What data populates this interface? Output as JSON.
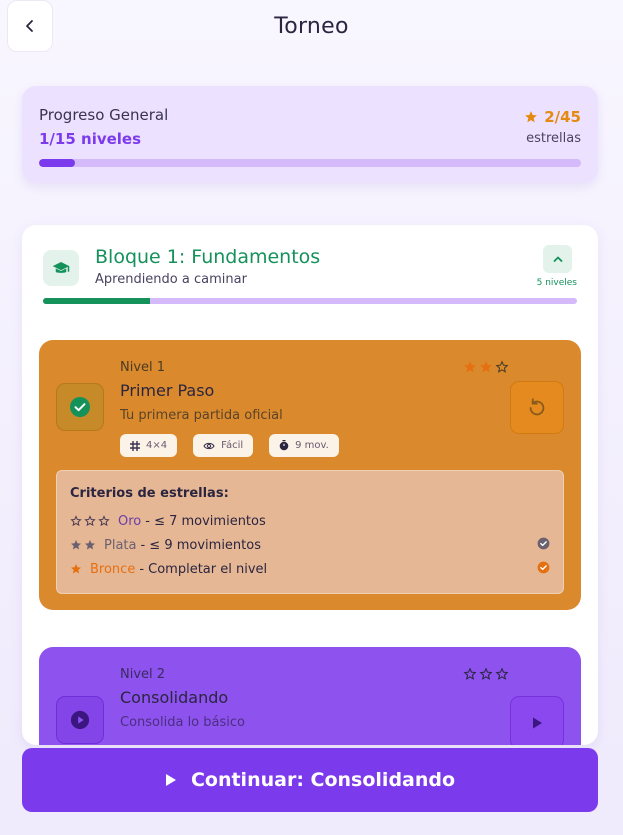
{
  "header": {
    "title": "Torneo"
  },
  "progress": {
    "label": "Progreso General",
    "levels_text": "1/15 niveles",
    "stars_text": "2/45",
    "stars_label": "estrellas",
    "fraction": 0.066
  },
  "block": {
    "title": "Bloque 1: Fundamentos",
    "subtitle": "Aprendiendo a caminar",
    "count": "5 niveles",
    "fraction": 0.2
  },
  "levels": [
    {
      "number": "Nivel 1",
      "name": "Primer Paso",
      "description": "Tu primera partida oficial",
      "stars_earned": 2,
      "stars_total": 3,
      "chips": {
        "grid": "4×4",
        "difficulty": "Fácil",
        "moves": "9 mov."
      }
    },
    {
      "number": "Nivel 2",
      "name": "Consolidando",
      "description": "Consolida lo básico",
      "stars_earned": 0,
      "stars_total": 3
    }
  ],
  "criteria": {
    "title": "Criterios de estrellas:",
    "rows": [
      {
        "stars": 3,
        "tier": "Oro",
        "desc": "- ≤ 7 movimientos",
        "achieved": false
      },
      {
        "stars": 2,
        "tier": "Plata",
        "desc": "- ≤ 9 movimientos",
        "achieved": true
      },
      {
        "stars": 1,
        "tier": "Bronce",
        "desc": "- Completar el nivel",
        "achieved": true
      }
    ]
  },
  "continue_button": {
    "label": "Continuar: Consolidando"
  },
  "colors": {
    "accent_purple": "#7c3aed",
    "green": "#15915a",
    "orange_star": "#e58a10",
    "level1_bg": "#da8a2d",
    "level2_bg": "#8e52ee"
  },
  "icons": {
    "back": "chevron-left-icon",
    "block": "graduation-cap-icon",
    "collapse": "chevron-up-icon",
    "completed": "check-circle-icon",
    "replay": "rotate-ccw-icon",
    "play": "play-icon",
    "grid": "grid-icon",
    "difficulty": "eye-icon",
    "moves": "timer-icon"
  }
}
